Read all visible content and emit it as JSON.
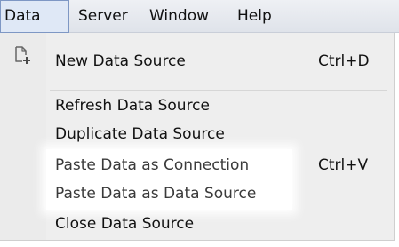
{
  "menubar": {
    "items": [
      "Data",
      "Server",
      "Window",
      "Help"
    ]
  },
  "data_menu": {
    "items": [
      {
        "label": "New Data Source",
        "shortcut": "Ctrl+D",
        "icon": "new-data-source-icon"
      },
      {
        "label": "Refresh Data Source",
        "shortcut": ""
      },
      {
        "label": "Duplicate Data Source",
        "shortcut": ""
      },
      {
        "label": "Paste Data as Connection",
        "shortcut": "Ctrl+V"
      },
      {
        "label": "Paste Data as Data Source",
        "shortcut": ""
      },
      {
        "label": "Close Data Source",
        "shortcut": ""
      }
    ]
  },
  "colors": {
    "menubar_bg": "#e4e8ee",
    "active_menu_border": "#7e97c4",
    "dropdown_bg": "#eeeeee",
    "highlight_bg": "#ffffff",
    "text": "#111111"
  }
}
